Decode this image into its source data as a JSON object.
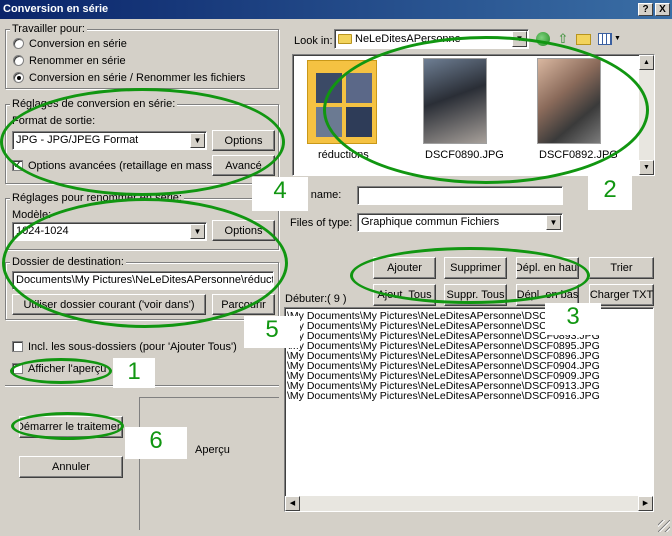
{
  "window": {
    "title": "Conversion en série",
    "help_label": "?",
    "close_label": "X"
  },
  "travailler": {
    "legend": "Travailler pour:",
    "options": [
      "Conversion en série",
      "Renommer en série",
      "Conversion en série / Renommer les fichiers"
    ],
    "selected_index": 2
  },
  "conversion": {
    "legend": "Réglages de conversion en série:",
    "format_label": "Format de sortie:",
    "format_value": "JPG - JPG/JPEG Format",
    "options_button": "Options",
    "advanced_checkbox": "Options avancées (retaillage en masse...)",
    "advanced_checked": true,
    "advanced_button": "Avancé"
  },
  "renommer": {
    "legend": "Réglages pour renommer en série:",
    "modele_label": "Modèle:",
    "modele_value": "1024-1024",
    "options_button": "Options"
  },
  "destination": {
    "legend": "Dossier de destination:",
    "path": "Documents\\My Pictures\\NeLeDitesAPersonne\\réductions\\",
    "use_current_button": "Utiliser dossier courant ('voir dans')",
    "browse_button": "Parcourir"
  },
  "checkboxes": {
    "subfolders": "Incl. les sous-dossiers (pour 'Ajouter Tous')",
    "preview": "Afficher l'aperçu"
  },
  "actions": {
    "start": "Démarrer le traitement",
    "cancel": "Annuler",
    "preview_label": "Aperçu"
  },
  "browser": {
    "look_in_label": "Look in:",
    "look_in_value": "NeLeDitesAPersonne",
    "items": [
      {
        "name": "réductions",
        "kind": "folder"
      },
      {
        "name": "DSCF0890.JPG",
        "kind": "photo"
      },
      {
        "name": "DSCF0892.JPG",
        "kind": "photo"
      }
    ],
    "file_name_label": "File name:",
    "file_name_value": "",
    "file_type_label": "Files of type:",
    "file_type_value": "Graphique commun Fichiers"
  },
  "queue_buttons": {
    "row1": [
      "Ajouter",
      "Supprimer",
      "Dépl. en haut",
      "Trier"
    ],
    "row2": [
      "Ajout. Tous",
      "Suppr. Tous",
      "Dépl. en bas",
      "Charger TXT"
    ]
  },
  "queue": {
    "label": "Débuter:",
    "count": "( 9 )",
    "files": [
      "\\My Documents\\My Pictures\\NeLeDitesAPersonne\\DSCF0890.JPG",
      "\\My Documents\\My Pictures\\NeLeDitesAPersonne\\DSCF0892.JPG",
      "\\My Documents\\My Pictures\\NeLeDitesAPersonne\\DSCF0893.JPG",
      "\\My Documents\\My Pictures\\NeLeDitesAPersonne\\DSCF0895.JPG",
      "\\My Documents\\My Pictures\\NeLeDitesAPersonne\\DSCF0896.JPG",
      "\\My Documents\\My Pictures\\NeLeDitesAPersonne\\DSCF0904.JPG",
      "\\My Documents\\My Pictures\\NeLeDitesAPersonne\\DSCF0909.JPG",
      "\\My Documents\\My Pictures\\NeLeDitesAPersonne\\DSCF0913.JPG",
      "\\My Documents\\My Pictures\\NeLeDitesAPersonne\\DSCF0916.JPG"
    ]
  },
  "annotations": {
    "numbers": [
      "1",
      "2",
      "3",
      "4",
      "5",
      "6"
    ],
    "color": "#119611"
  }
}
